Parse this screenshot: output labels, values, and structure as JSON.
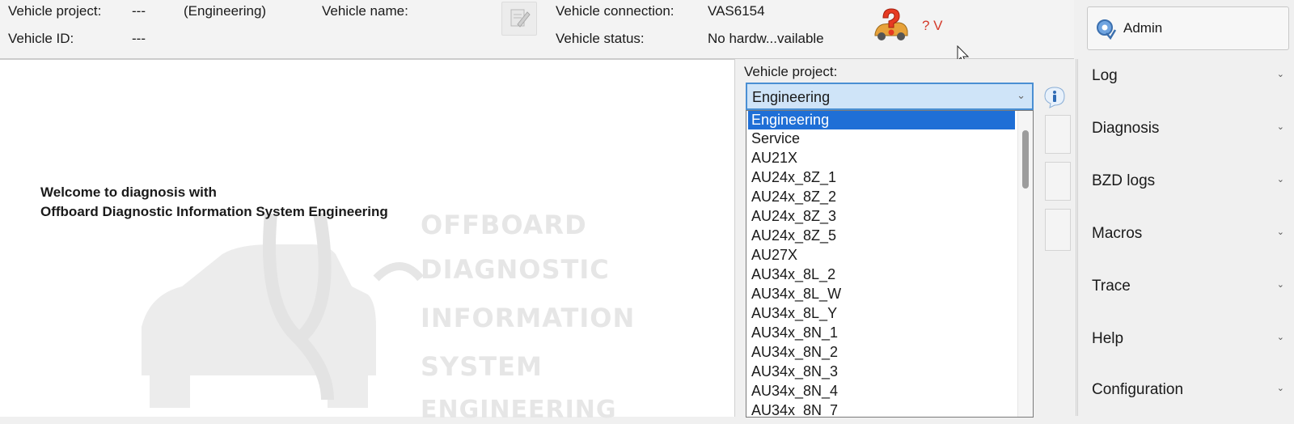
{
  "header": {
    "vehicle_project_label": "Vehicle project:",
    "vehicle_project_value": "---",
    "vehicle_project_mode": "(Engineering)",
    "vehicle_name_label": "Vehicle name:",
    "vehicle_id_label": "Vehicle ID:",
    "vehicle_id_value": "---",
    "vehicle_connection_label": "Vehicle connection:",
    "vehicle_connection_value": "VAS6154",
    "vehicle_status_label": "Vehicle status:",
    "vehicle_status_value": "No hardw...vailable",
    "voltage": "? V"
  },
  "admin": {
    "label": "Admin"
  },
  "welcome": {
    "line1": "Welcome to diagnosis with",
    "line2": "Offboard Diagnostic Information System Engineering"
  },
  "watermark": {
    "line1": "OFFBOARD",
    "line2": "DIAGNOSTIC",
    "line3": "INFORMATION",
    "line4": "SYSTEM",
    "line5": "ENGINEERING"
  },
  "project_selector": {
    "label": "Vehicle project:",
    "selected": "Engineering",
    "options": [
      "Engineering",
      "Service",
      "AU21X",
      "AU24x_8Z_1",
      "AU24x_8Z_2",
      "AU24x_8Z_3",
      "AU24x_8Z_5",
      "AU27X",
      "AU34x_8L_2",
      "AU34x_8L_W",
      "AU34x_8L_Y",
      "AU34x_8N_1",
      "AU34x_8N_2",
      "AU34x_8N_3",
      "AU34x_8N_4",
      "AU34x_8N_7"
    ]
  },
  "sidebar": {
    "items": [
      {
        "label": "Log"
      },
      {
        "label": "Diagnosis"
      },
      {
        "label": "BZD logs"
      },
      {
        "label": "Macros"
      },
      {
        "label": "Trace"
      },
      {
        "label": "Help"
      },
      {
        "label": "Configuration"
      }
    ]
  },
  "colors": {
    "selection": "#1f6fd6",
    "voltage_text": "#d43a2a",
    "combo_focus": "#4a8fd3"
  }
}
